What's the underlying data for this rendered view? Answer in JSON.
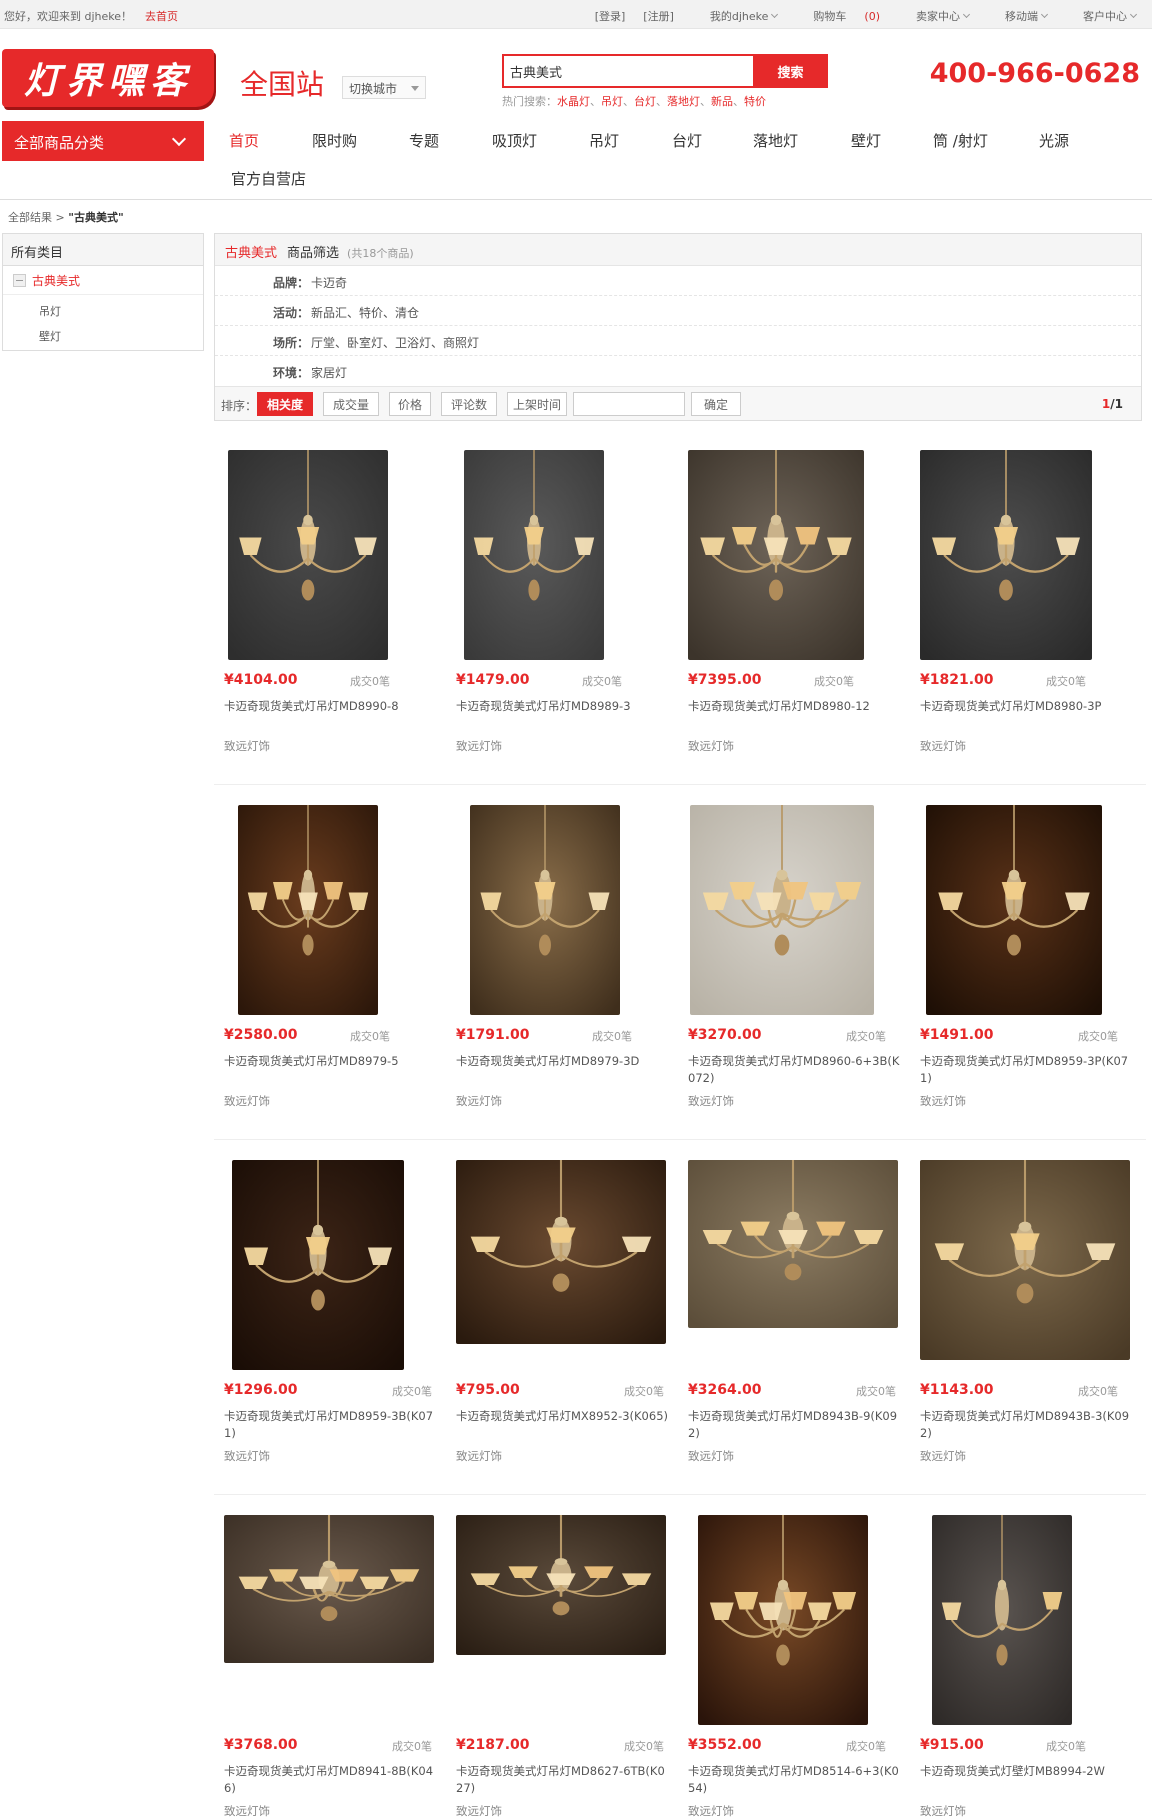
{
  "topbar": {
    "welcome": "您好，欢迎来到 djheke！",
    "home_link": "去首页",
    "login": "[登录]",
    "register": "[注册]",
    "my_account": "我的djheke",
    "cart_label": "购物车",
    "cart_count": "(0)",
    "seller_center": "卖家中心",
    "mobile": "移动端",
    "service": "客户中心"
  },
  "header": {
    "logo_text": "灯界嘿客",
    "site_name": "全国站",
    "switch_city": "切换城市",
    "hotline": "400-966-0628"
  },
  "search": {
    "value": "古典美式",
    "button": "搜索",
    "hot_label": "热门搜索：",
    "hot_keywords": [
      "水晶灯",
      "吊灯",
      "台灯",
      "落地灯",
      "新品",
      "特价"
    ]
  },
  "nav": {
    "all_categories": "全部商品分类",
    "items": [
      "首页",
      "限时购",
      "专题",
      "吸顶灯",
      "吊灯",
      "台灯",
      "落地灯",
      "壁灯",
      "筒 /射灯",
      "光源"
    ],
    "second_row": "官方自营店"
  },
  "breadcrumb": {
    "root": "全部结果",
    "sep": ">",
    "current": "\"古典美式\""
  },
  "sidebar": {
    "title": "所有类目",
    "current": "古典美式",
    "children": [
      "吊灯",
      "壁灯"
    ]
  },
  "filter": {
    "keyword": "古典美式",
    "title": "商品筛选",
    "count": "(共18个商品)",
    "rows": [
      {
        "label": "品牌：",
        "value": "卡迈奇"
      },
      {
        "label": "活动：",
        "value": "新品汇、特价、清仓"
      },
      {
        "label": "场所：",
        "value": "厅堂、卧室灯、卫浴灯、商照灯"
      },
      {
        "label": "环境：",
        "value": "家居灯"
      }
    ],
    "sort_label": "排序：",
    "sort_options": [
      "相关度",
      "成交量",
      "价格",
      "评论数",
      "上架时间"
    ],
    "confirm": "确定",
    "page_current": "1",
    "page_total": "/1"
  },
  "products": [
    {
      "price": "¥4104.00",
      "sold": "成交0笔",
      "title": "卡迈奇现货美式灯吊灯MD8990-8",
      "shop": "致远灯饰"
    },
    {
      "price": "¥1479.00",
      "sold": "成交0笔",
      "title": "卡迈奇现货美式灯吊灯MD8989-3",
      "shop": "致远灯饰"
    },
    {
      "price": "¥7395.00",
      "sold": "成交0笔",
      "title": "卡迈奇现货美式灯吊灯MD8980-12",
      "shop": "致远灯饰"
    },
    {
      "price": "¥1821.00",
      "sold": "成交0笔",
      "title": "卡迈奇现货美式灯吊灯MD8980-3P",
      "shop": "致远灯饰"
    },
    {
      "price": "¥2580.00",
      "sold": "成交0笔",
      "title": "卡迈奇现货美式灯吊灯MD8979-5",
      "shop": "致远灯饰"
    },
    {
      "price": "¥1791.00",
      "sold": "成交0笔",
      "title": "卡迈奇现货美式灯吊灯MD8979-3D",
      "shop": "致远灯饰"
    },
    {
      "price": "¥3270.00",
      "sold": "成交0笔",
      "title": "卡迈奇现货美式灯吊灯MD8960-6+3B(K072)",
      "shop": "致远灯饰"
    },
    {
      "price": "¥1491.00",
      "sold": "成交0笔",
      "title": "卡迈奇现货美式灯吊灯MD8959-3P(K071)",
      "shop": "致远灯饰"
    },
    {
      "price": "¥1296.00",
      "sold": "成交0笔",
      "title": "卡迈奇现货美式灯吊灯MD8959-3B(K071)",
      "shop": "致远灯饰"
    },
    {
      "price": "¥795.00",
      "sold": "成交0笔",
      "title": "卡迈奇现货美式灯吊灯MX8952-3(K065)",
      "shop": "致远灯饰"
    },
    {
      "price": "¥3264.00",
      "sold": "成交0笔",
      "title": "卡迈奇现货美式灯吊灯MD8943B-9(K092)",
      "shop": "致远灯饰"
    },
    {
      "price": "¥1143.00",
      "sold": "成交0笔",
      "title": "卡迈奇现货美式灯吊灯MD8943B-3(K092)",
      "shop": "致远灯饰"
    },
    {
      "price": "¥3768.00",
      "sold": "成交0笔",
      "title": "卡迈奇现货美式灯吊灯MD8941-8B(K046)",
      "shop": "致远灯饰"
    },
    {
      "price": "¥2187.00",
      "sold": "成交0笔",
      "title": "卡迈奇现货美式灯吊灯MD8627-6TB(K027)",
      "shop": "致远灯饰"
    },
    {
      "price": "¥3552.00",
      "sold": "成交0笔",
      "title": "卡迈奇现货美式灯吊灯MD8514-6+3(K054)",
      "shop": "致远灯饰"
    },
    {
      "price": "¥915.00",
      "sold": "成交0笔",
      "title": "卡迈奇现货美式灯壁灯MB8994-2W",
      "shop": "致远灯饰"
    }
  ],
  "colors": {
    "accent": "#e6292a",
    "top_bar": "#f2f2f2"
  }
}
